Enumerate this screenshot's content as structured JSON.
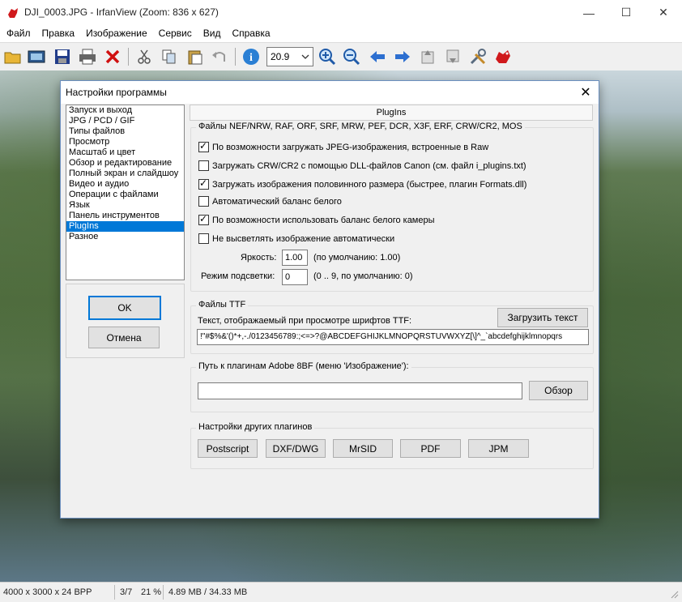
{
  "window": {
    "title": "DJI_0003.JPG - IrfanView (Zoom: 836 x 627)",
    "minimize": "—",
    "maximize": "☐",
    "close": "✕"
  },
  "menu": [
    "Файл",
    "Правка",
    "Изображение",
    "Сервис",
    "Вид",
    "Справка"
  ],
  "toolbar": {
    "zoom_value": "20.9",
    "icons": [
      "open-folder-icon",
      "slideshow-icon",
      "save-icon",
      "print-icon",
      "delete-icon",
      "cut-icon",
      "copy-icon",
      "paste-icon",
      "undo-icon",
      "info-icon",
      "zoom-in-icon",
      "zoom-out-icon",
      "prev-icon",
      "next-icon",
      "first-page-icon",
      "last-page-icon",
      "settings-icon",
      "irfanview-logo-icon"
    ]
  },
  "status": {
    "dimensions": "4000 x 3000 x 24 BPP",
    "index": "3/7",
    "zoom": "21 %",
    "memory": "4.89 MB / 34.33 MB"
  },
  "dialog": {
    "title": "Настройки программы",
    "categories": [
      "Запуск и выход",
      "JPG / PCD / GIF",
      "Типы файлов",
      "Просмотр",
      "Масштаб и цвет",
      "Обзор и редактирование",
      "Полный экран и слайдшоу",
      "Видео и аудио",
      "Операции с файлами",
      "Язык",
      "Панель инструментов",
      "PlugIns",
      "Разное"
    ],
    "selected_category": "PlugIns",
    "ok": "OK",
    "cancel": "Отмена",
    "panel_title": "PlugIns",
    "raw_group": {
      "label": "Файлы NEF/NRW, RAF, ORF, SRF, MRW, PEF, DCR, X3F, ERF, CRW/CR2, MOS",
      "options": [
        {
          "label": "По возможности загружать JPEG-изображения, встроенные в Raw",
          "checked": true
        },
        {
          "label": "Загружать CRW/CR2 с помощью DLL-файлов Canon (см. файл i_plugins.txt)",
          "checked": false
        },
        {
          "label": "Загружать изображения половинного размера (быстрее, плагин Formats.dll)",
          "checked": true
        },
        {
          "label": "Автоматический баланс белого",
          "checked": false
        },
        {
          "label": "По возможности использовать баланс белого камеры",
          "checked": true
        },
        {
          "label": "Не высветлять изображение автоматически",
          "checked": false
        }
      ],
      "brightness_label": "Яркость:",
      "brightness_value": "1.00",
      "brightness_hint": "(по умолчанию: 1.00)",
      "highlight_label": "Режим подсветки:",
      "highlight_value": "0",
      "highlight_hint": "(0 .. 9, по умолчанию: 0)"
    },
    "ttf_group": {
      "label": "Файлы TTF",
      "text_label": "Текст, отображаемый при просмотре шрифтов TTF:",
      "load_button": "Загрузить текст",
      "text_value": "!\"#$%&'()*+,-./0123456789:;<=>?@ABCDEFGHIJKLMNOPQRSTUVWXYZ[\\]^_`abcdefghijklmnopqrs"
    },
    "adobe_group": {
      "label": "Путь к плагинам Adobe 8BF (меню 'Изображение'):",
      "path_value": "",
      "browse_button": "Обзор"
    },
    "other_group": {
      "label": "Настройки других плагинов",
      "buttons": [
        "Postscript",
        "DXF/DWG",
        "MrSID",
        "PDF",
        "JPM"
      ]
    }
  }
}
